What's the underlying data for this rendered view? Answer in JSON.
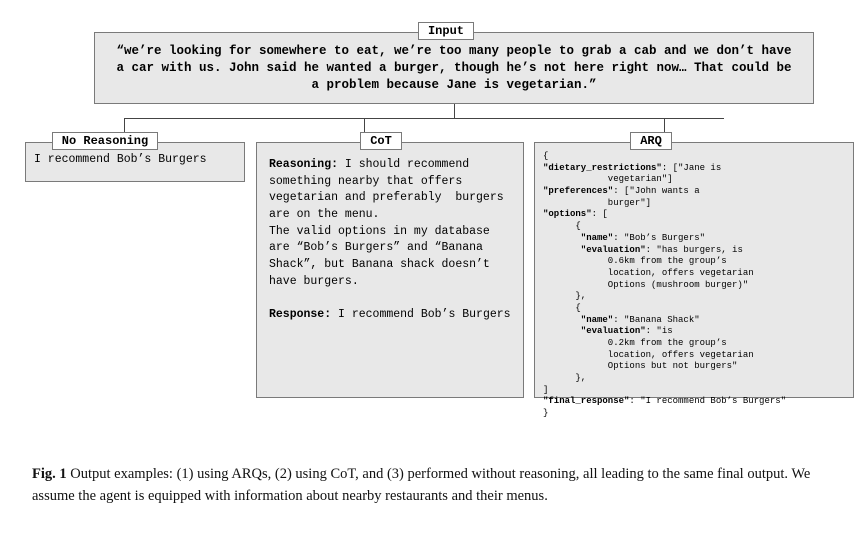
{
  "labels": {
    "input": "Input",
    "nr": "No Reasoning",
    "cot": "CoT",
    "arq": "ARQ"
  },
  "input_text": "“we’re looking for somewhere to eat, we’re too many people to grab a cab and we don’t have a car with us. John said he wanted a burger, though he’s not here right now… That could be a problem because Jane is vegetarian.”",
  "no_reasoning": "I recommend Bob’s Burgers",
  "cot": {
    "reasoning_label": "Reasoning:",
    "reasoning_body": "I should recommend something nearby that offers vegetarian and preferably  burgers are on the menu.\nThe valid options in my database are “Bob’s Burgers” and “Banana Shack”, but Banana shack doesn’t have burgers.",
    "response_label": "Response:",
    "response_body": "I recommend Bob’s Burgers"
  },
  "arq": {
    "l01": "{",
    "l02": "\"dietary_restrictions\"",
    "l02b": ": [\"Jane is",
    "l03": "            vegetarian\"]",
    "l04": "\"preferences\"",
    "l04b": ": [\"John wants a",
    "l05": "            burger\"]",
    "l06": "\"options\"",
    "l06b": ": [",
    "l07": "      {",
    "l08": "       \"name\"",
    "l08b": ": \"Bob’s Burgers\"",
    "l09": "       \"evaluation\"",
    "l09b": ": \"has burgers, is",
    "l10": "            0.6km from the group’s",
    "l11": "            location, offers vegetarian",
    "l12": "            Options (mushroom burger)\"",
    "l13": "      },",
    "l14": "      {",
    "l15": "       \"name\"",
    "l15b": ": \"Banana Shack\"",
    "l16": "       \"evaluation\"",
    "l16b": ": \"is",
    "l17": "            0.2km from the group’s",
    "l18": "            location, offers vegetarian",
    "l19": "            Options but not burgers\"",
    "l20": "      },",
    "l21": "]",
    "l22": "\"final_response\"",
    "l22b": ": \"I recommend Bob’s Burgers\"",
    "l23": "}"
  },
  "caption": {
    "fignum": "Fig. 1",
    "text": "  Output examples: (1) using ARQs, (2) using CoT, and (3) performed without reasoning, all leading to the same final output. We assume the agent is equipped with information about nearby restaurants and their menus."
  }
}
